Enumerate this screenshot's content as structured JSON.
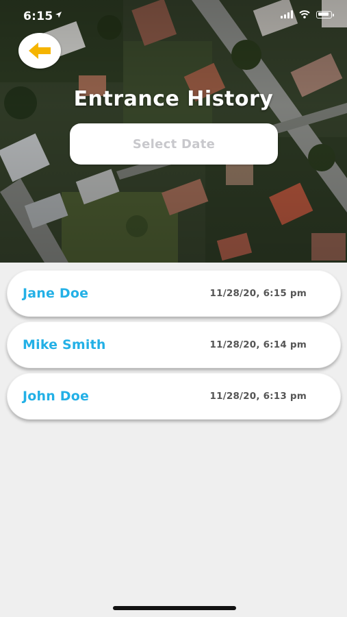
{
  "status_bar": {
    "time": "6:15"
  },
  "header": {
    "back_icon": "arrow-left-icon",
    "title": "Entrance History",
    "date_button_label": "Select Date"
  },
  "colors": {
    "accent_name": "#23b0e6",
    "back_arrow": "#f5b400"
  },
  "entries": [
    {
      "name": "Jane Doe",
      "time": "11/28/20, 6:15 pm"
    },
    {
      "name": "Mike Smith",
      "time": "11/28/20, 6:14 pm"
    },
    {
      "name": "John Doe",
      "time": "11/28/20, 6:13 pm"
    }
  ]
}
